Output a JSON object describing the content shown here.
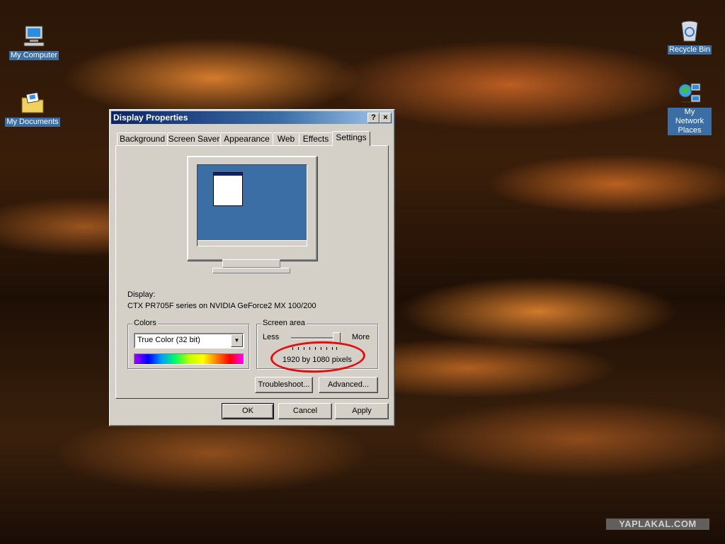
{
  "desktop": {
    "icons": [
      {
        "label": "My Computer"
      },
      {
        "label": "My Documents"
      },
      {
        "label": "Recycle Bin"
      },
      {
        "label": "My Network Places"
      }
    ],
    "watermark": "YAPLAKAL.COM"
  },
  "dialog": {
    "title": "Display Properties",
    "help_button": "?",
    "close_button": "×",
    "tabs": [
      {
        "label": "Background"
      },
      {
        "label": "Screen Saver"
      },
      {
        "label": "Appearance"
      },
      {
        "label": "Web"
      },
      {
        "label": "Effects"
      },
      {
        "label": "Settings",
        "active": true
      }
    ],
    "display_label": "Display:",
    "display_value": "CTX PR705F series on NVIDIA GeForce2 MX 100/200",
    "colors": {
      "group_label": "Colors",
      "selected": "True Color (32 bit)"
    },
    "screen_area": {
      "group_label": "Screen area",
      "less_label": "Less",
      "more_label": "More",
      "resolution": "1920 by 1080 pixels",
      "slider_position": 1.0
    },
    "buttons": {
      "troubleshoot": "Troubleshoot...",
      "advanced": "Advanced...",
      "ok": "OK",
      "cancel": "Cancel",
      "apply": "Apply"
    },
    "annotation_color": "#e01010"
  }
}
